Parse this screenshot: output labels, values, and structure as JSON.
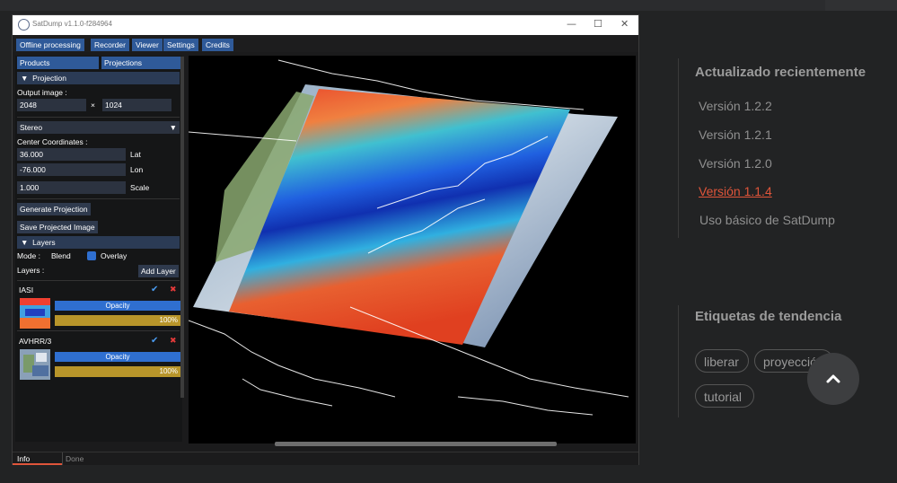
{
  "window": {
    "title": "SatDump v1.1.0-f284964",
    "controls": {
      "minimize": "—",
      "maximize": "☐",
      "close": "✕"
    }
  },
  "menu": [
    "Offline processing",
    "Recorder",
    "Viewer",
    "Settings",
    "Credits"
  ],
  "panel": {
    "tabs": [
      "Products",
      "Projections"
    ],
    "projection_header": "Projection",
    "output_image_label": "Output image :",
    "width_value": "2048",
    "times": "×",
    "height_value": "1024",
    "projection_type": "Stereo",
    "center_coords_label": "Center Coordinates :",
    "lat_value": "36.000",
    "lat_label": "Lat",
    "lon_value": "-76.000",
    "lon_label": "Lon",
    "scale_value": "1.000",
    "scale_label": "Scale",
    "generate_button": "Generate Projection",
    "save_button": "Save Projected Image",
    "layers_header": "Layers",
    "mode_label": "Mode :",
    "mode_blend": "Blend",
    "mode_overlay": "Overlay",
    "layers_label": "Layers :",
    "add_layer_button": "Add Layer",
    "layers": [
      {
        "name": "IASI",
        "opacity_label": "Opacity",
        "opacity_value": "100%"
      },
      {
        "name": "AVHRR/3",
        "opacity_label": "Opacity",
        "opacity_value": "100%"
      }
    ]
  },
  "status": {
    "tab": "Info",
    "message": "Done"
  },
  "sidebar": {
    "recent_heading": "Actualizado recientemente",
    "recent_links": [
      "Versión 1.2.2",
      "Versión 1.2.1",
      "Versión 1.2.0",
      "Versión 1.1.4",
      "Uso básico de SatDump"
    ],
    "tags_heading": "Etiquetas de tendencia",
    "tags": [
      "liberar",
      "proyección",
      "tutorial"
    ]
  },
  "colors": {
    "accent": "#e0553a",
    "button_blue": "#2f5a99",
    "opacity_gold": "#b8952a"
  },
  "icons": {
    "scroll_top": "chevron-up-icon"
  }
}
